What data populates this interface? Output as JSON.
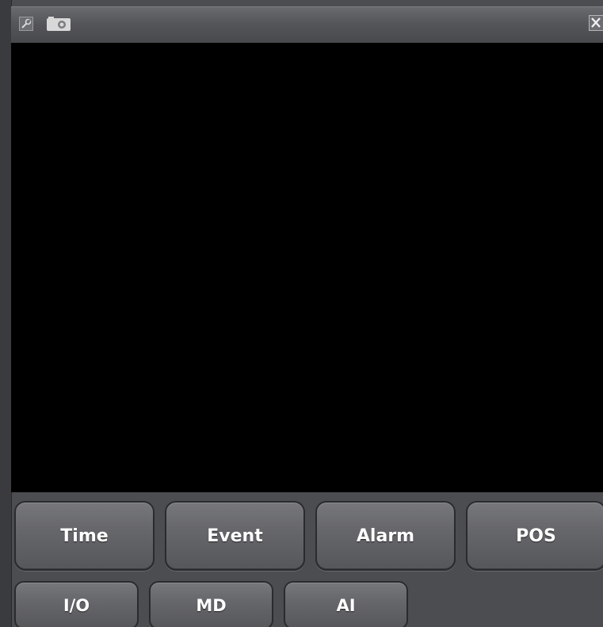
{
  "titlebar": {
    "icons": [
      "settings-icon",
      "camera-icon",
      "close-icon"
    ]
  },
  "video": {
    "status": ""
  },
  "search_buttons": {
    "row1": [
      "Time",
      "Event",
      "Alarm",
      "POS"
    ],
    "row2": [
      "I/O",
      "MD",
      "AI"
    ]
  },
  "colors": {
    "background": "#4c4d51",
    "video": "#000000",
    "button_face": "#66676b",
    "button_text": "#ffffff"
  }
}
